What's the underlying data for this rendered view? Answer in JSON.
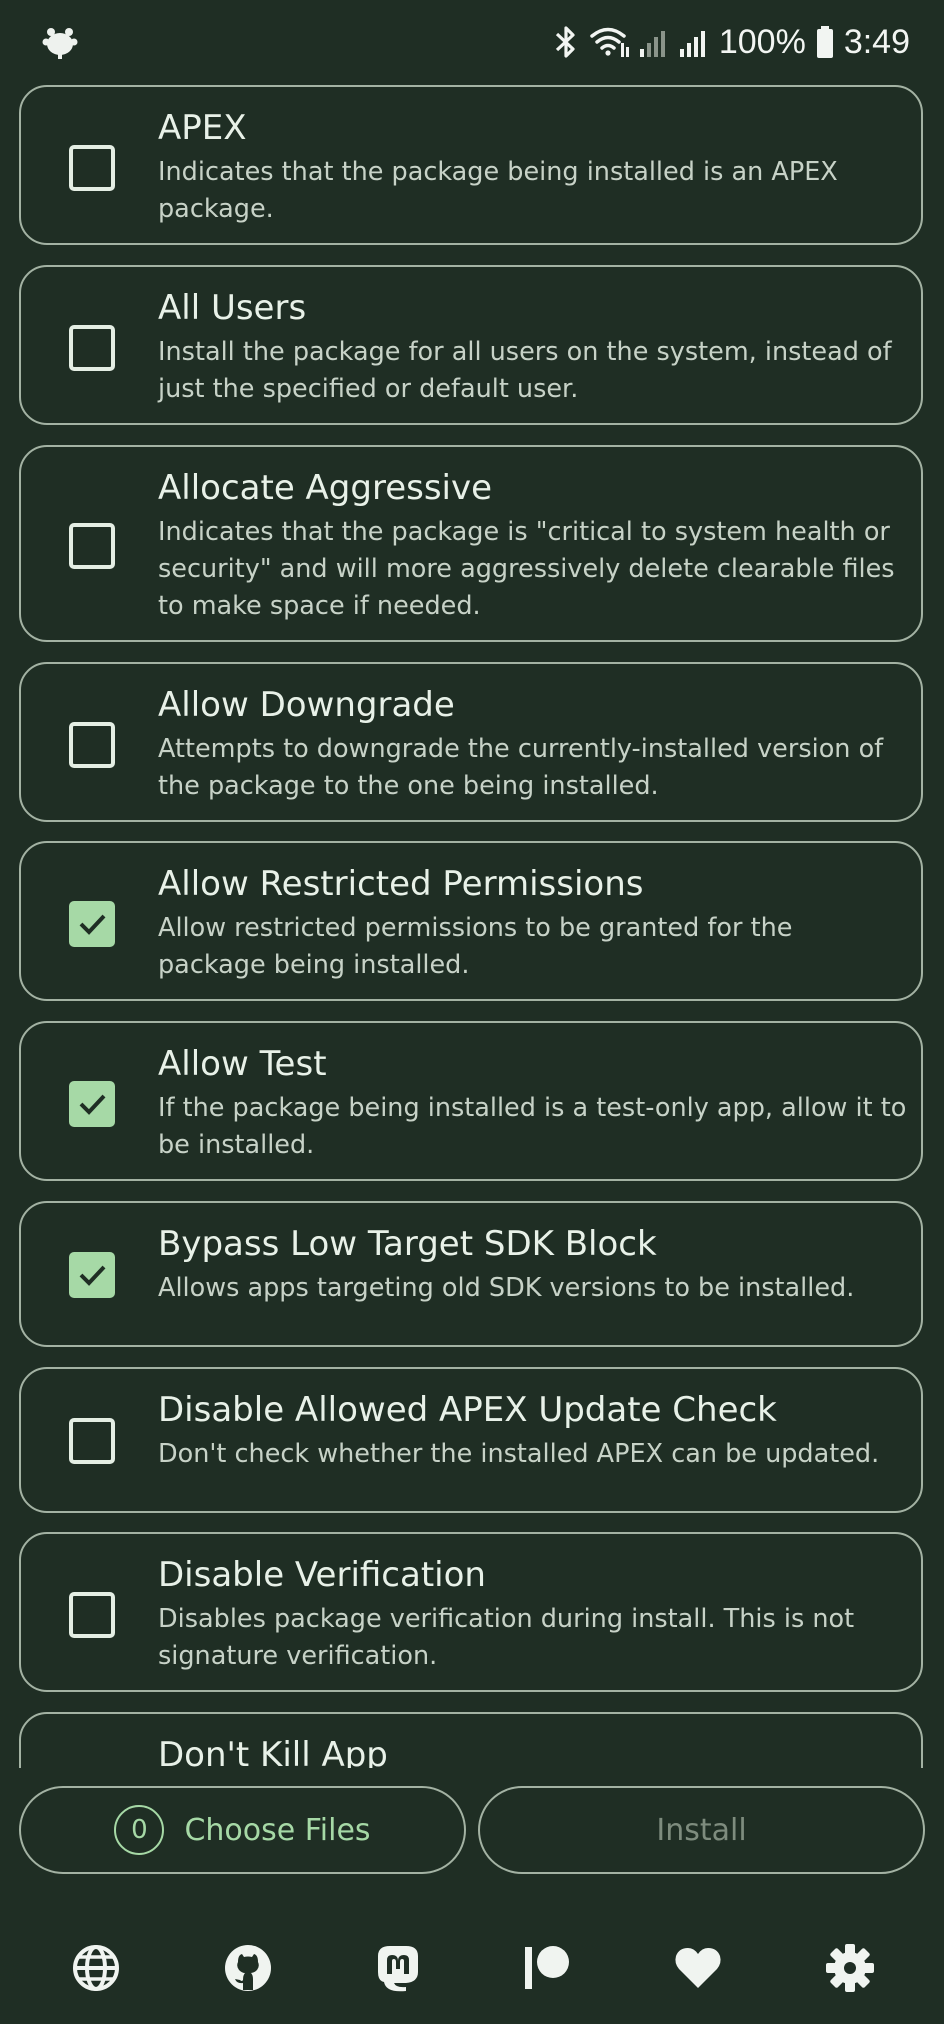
{
  "status_bar": {
    "battery_percent": "100%",
    "time": "3:49"
  },
  "options": [
    {
      "title": "APEX",
      "description": "Indicates that the package being installed is an APEX package.",
      "checked": false
    },
    {
      "title": "All Users",
      "description": "Install the package for all users on the system, instead of just the specified or default user.",
      "checked": false
    },
    {
      "title": "Allocate Aggressive",
      "description": "Indicates that the package is \"critical to system health or security\" and will more aggressively delete clearable files to make space if needed.",
      "checked": false
    },
    {
      "title": "Allow Downgrade",
      "description": "Attempts to downgrade the currently-installed version of the package to the one being installed.",
      "checked": false
    },
    {
      "title": "Allow Restricted Permissions",
      "description": "Allow restricted permissions to be granted for the package being installed.",
      "checked": true
    },
    {
      "title": "Allow Test",
      "description": "If the package being installed is a test-only app, allow it to be installed.",
      "checked": true
    },
    {
      "title": "Bypass Low Target SDK Block",
      "description": "Allows apps targeting old SDK versions to be installed.",
      "checked": true
    },
    {
      "title": "Disable Allowed APEX Update Check",
      "description": "Don't check whether the installed APEX can be updated.",
      "checked": false
    },
    {
      "title": "Disable Verification",
      "description": "Disables package verification during install. This is not signature verification.",
      "checked": false
    },
    {
      "title": "Don't Kill App",
      "description": "",
      "checked": false
    }
  ],
  "actions": {
    "file_count": "0",
    "choose_label": "Choose Files",
    "install_label": "Install"
  },
  "nav": [
    "globe-icon",
    "github-icon",
    "mastodon-icon",
    "patreon-icon",
    "heart-icon",
    "gear-icon"
  ],
  "colors": {
    "background": "#1f2e24",
    "accent": "#a6d9a6",
    "outline": "#a3b2a3",
    "disabled_text": "#7e8c7e"
  }
}
